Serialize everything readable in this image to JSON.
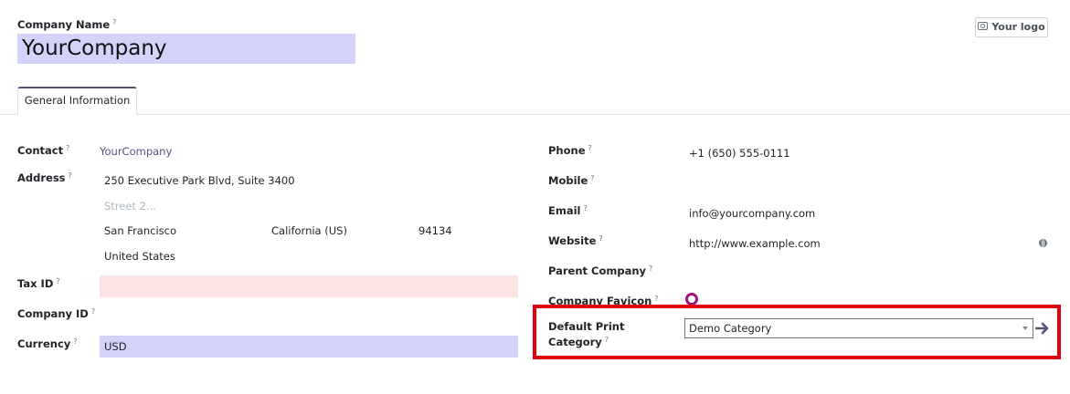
{
  "header": {
    "company_name_label": "Company Name",
    "help_mark": "?",
    "company_name_value": "YourCompany",
    "logo_button": "Your logo"
  },
  "tabs": [
    {
      "label": "General Information",
      "active": true
    }
  ],
  "left": {
    "contact": {
      "label": "Contact",
      "value": "YourCompany"
    },
    "address": {
      "label": "Address",
      "street": "250 Executive Park Blvd, Suite 3400",
      "street2_placeholder": "Street 2...",
      "city": "San Francisco",
      "state": "California (US)",
      "zip": "94134",
      "country": "United States"
    },
    "tax_id": {
      "label": "Tax ID",
      "value": ""
    },
    "company_id": {
      "label": "Company ID",
      "value": ""
    },
    "currency": {
      "label": "Currency",
      "value": "USD"
    }
  },
  "right": {
    "phone": {
      "label": "Phone",
      "value": "+1 (650) 555-0111"
    },
    "mobile": {
      "label": "Mobile",
      "value": ""
    },
    "email": {
      "label": "Email",
      "value": "info@yourcompany.com"
    },
    "website": {
      "label": "Website",
      "value": "http://www.example.com"
    },
    "parent_company": {
      "label": "Parent Company",
      "value": ""
    },
    "favicon": {
      "label": "Company Favicon"
    },
    "default_print_category": {
      "label_line1": "Default Print",
      "label_line2": "Category",
      "value": "Demo Category"
    }
  },
  "colors": {
    "accent": "#5b4f7f",
    "required_field": "#d3d3fa",
    "invalid_field": "#fde4e4",
    "highlight_box": "#e3000f"
  },
  "icons": [
    "camera-icon",
    "globe-icon",
    "favicon-icon",
    "internal-link-arrow-icon",
    "dropdown-caret-icon"
  ]
}
